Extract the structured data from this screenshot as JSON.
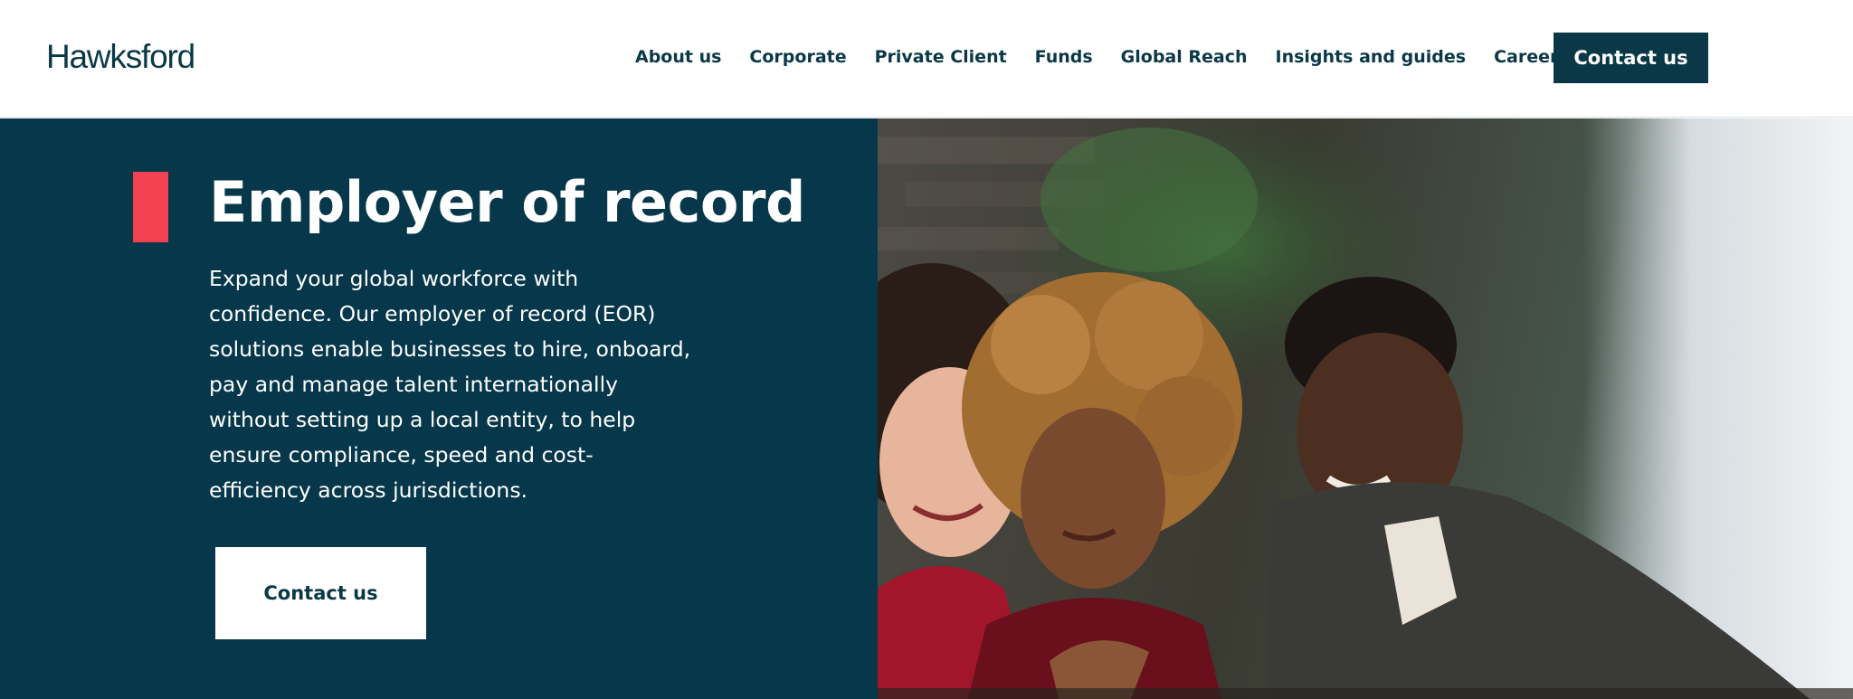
{
  "header": {
    "logo": "Hawksford",
    "nav": [
      "About us",
      "Corporate",
      "Private Client",
      "Funds",
      "Global Reach",
      "Insights and guides",
      "Careers"
    ],
    "cta_label": "Contact us"
  },
  "hero": {
    "title": "Employer of record",
    "description_lines": [
      "Expand your global workforce with",
      "confidence. Our employer of record (EOR)",
      "solutions enable businesses to hire, onboard,",
      "pay and manage talent internationally",
      "without setting up a local entity, to help",
      "ensure compliance, speed and cost-",
      "efficiency across jurisdictions."
    ],
    "cta_label": "Contact us",
    "accent_color": "#f24150",
    "panel_color": "#06374a"
  }
}
